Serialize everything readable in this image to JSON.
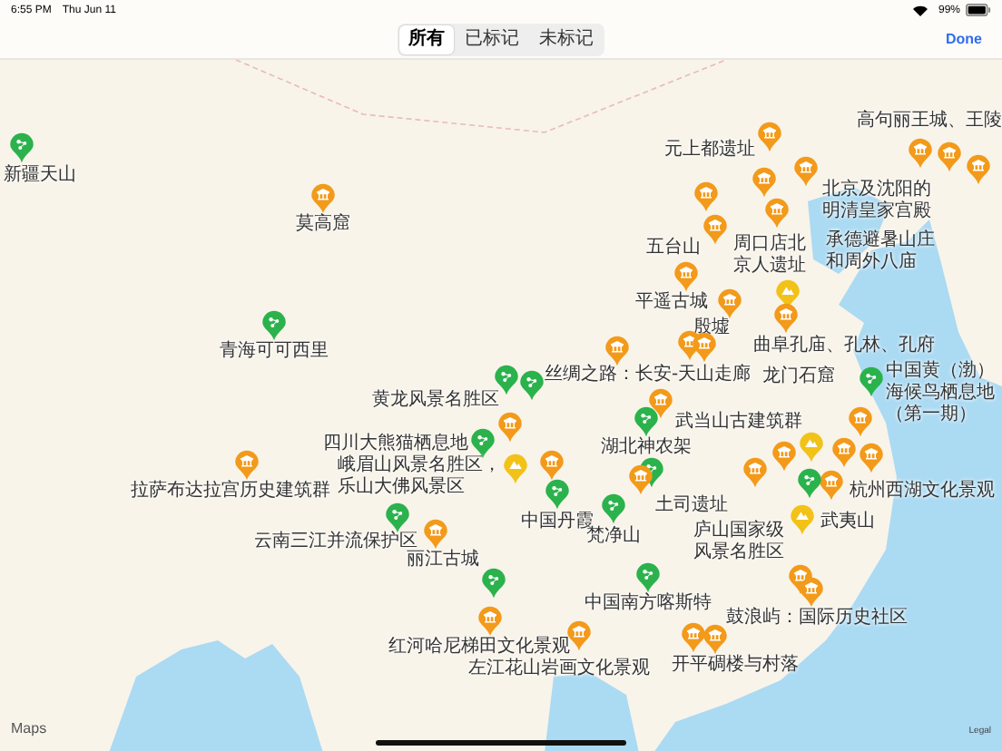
{
  "status_bar": {
    "time": "6:55 PM",
    "date": "Thu Jun 11",
    "battery": "99%"
  },
  "filter": {
    "segments": [
      {
        "label": "所有",
        "selected": true
      },
      {
        "label": "已标记",
        "selected": false
      },
      {
        "label": "未标记",
        "selected": false
      }
    ]
  },
  "done_button": "Done",
  "map": {
    "pins": [
      {
        "kind": "nature",
        "label": "新疆天山"
      },
      {
        "kind": "culture",
        "label": "莫高窟"
      },
      {
        "kind": "nature",
        "label": "青海可可西里"
      },
      {
        "kind": "culture",
        "label": "元上都遗址"
      },
      {
        "kind": "culture",
        "label": "高句丽王城、王陵"
      },
      {
        "kind": "culture"
      },
      {
        "kind": "culture"
      },
      {
        "kind": "culture",
        "label": "北京及沈阳的明清皇家宫殿"
      },
      {
        "kind": "culture",
        "label": "五台山"
      },
      {
        "kind": "culture",
        "label": "周口店北京人遗址"
      },
      {
        "kind": "culture",
        "label": "承德避暑山庄和周外八庙"
      },
      {
        "kind": "culture"
      },
      {
        "kind": "culture",
        "label": "平遥古城"
      },
      {
        "kind": "culture",
        "label": "殷墟"
      },
      {
        "kind": "mixed"
      },
      {
        "kind": "culture",
        "label": "曲阜孔庙、孔林、孔府"
      },
      {
        "kind": "culture"
      },
      {
        "kind": "culture",
        "label": "丝绸之路：长安-天山走廊"
      },
      {
        "kind": "culture",
        "label": "龙门石窟"
      },
      {
        "kind": "nature"
      },
      {
        "kind": "nature",
        "label": "黄龙风景名胜区"
      },
      {
        "kind": "culture",
        "label": "武当山古建筑群"
      },
      {
        "kind": "nature",
        "label": "湖北神农架"
      },
      {
        "kind": "culture"
      },
      {
        "kind": "nature",
        "label": "四川大熊猫栖息地"
      },
      {
        "kind": "culture",
        "label": "拉萨布达拉宫历史建筑群"
      },
      {
        "kind": "mixed",
        "label": "峨眉山风景名胜区，乐山大佛风景区"
      },
      {
        "kind": "culture"
      },
      {
        "kind": "nature",
        "label": "云南三江并流保护区"
      },
      {
        "kind": "culture",
        "label": "丽江古城"
      },
      {
        "kind": "nature",
        "label": "中国丹霞"
      },
      {
        "kind": "nature"
      },
      {
        "kind": "culture",
        "label": "土司遗址"
      },
      {
        "kind": "nature",
        "label": "梵净山"
      },
      {
        "kind": "nature",
        "label": "中国黄（渤）海候鸟栖息地（第一期）"
      },
      {
        "kind": "culture"
      },
      {
        "kind": "culture"
      },
      {
        "kind": "culture"
      },
      {
        "kind": "culture",
        "label": "杭州西湖文化景观"
      },
      {
        "kind": "mixed"
      },
      {
        "kind": "culture"
      },
      {
        "kind": "culture",
        "label": "庐山国家级风景名胜区"
      },
      {
        "kind": "nature"
      },
      {
        "kind": "mixed",
        "label": "武夷山"
      },
      {
        "kind": "nature",
        "label": "中国南方喀斯特"
      },
      {
        "kind": "nature"
      },
      {
        "kind": "culture",
        "label": "红河哈尼梯田文化景观"
      },
      {
        "kind": "culture"
      },
      {
        "kind": "culture",
        "label": "鼓浪屿：国际历史社区"
      },
      {
        "kind": "culture",
        "label": "左江花山岩画文化景观"
      },
      {
        "kind": "culture"
      },
      {
        "kind": "culture",
        "label": "开平碉楼与村落"
      }
    ],
    "logo": "Maps",
    "legal": "Legal"
  }
}
